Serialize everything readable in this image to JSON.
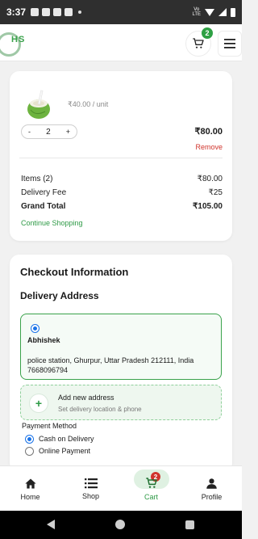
{
  "status_bar": {
    "time": "3:37",
    "network_label_top": "Vo",
    "network_label_bottom": "LTE"
  },
  "header": {
    "logo_text": "HS",
    "cart_count": "2"
  },
  "cart": {
    "item": {
      "unit_price": "₹40.00 / unit",
      "quantity": "2",
      "decrement_label": "-",
      "increment_label": "+",
      "line_total": "₹80.00",
      "remove_label": "Remove"
    },
    "summary": {
      "items_label": "Items (2)",
      "items_value": "₹80.00",
      "delivery_label": "Delivery Fee",
      "delivery_value": "₹25",
      "grand_label": "Grand Total",
      "grand_value": "₹105.00"
    },
    "continue_label": "Continue Shopping"
  },
  "checkout": {
    "title": "Checkout Information",
    "delivery_title": "Delivery Address",
    "address": {
      "name": "Abhishek",
      "line": "police station, Ghurpur, Uttar Pradesh 212111, India 7668096794"
    },
    "add_new": {
      "title": "Add new address",
      "subtitle": "Set delivery location & phone"
    },
    "payment": {
      "title": "Payment Method",
      "options": [
        "Cash on Delivery",
        "Online Payment"
      ]
    }
  },
  "bottom_nav": {
    "items": [
      "Home",
      "Shop",
      "Cart",
      "Profile"
    ],
    "cart_badge": "2"
  },
  "colors": {
    "accent_green": "#2e9a46",
    "remove_red": "#d0342c",
    "radio_blue": "#1a73e8"
  }
}
